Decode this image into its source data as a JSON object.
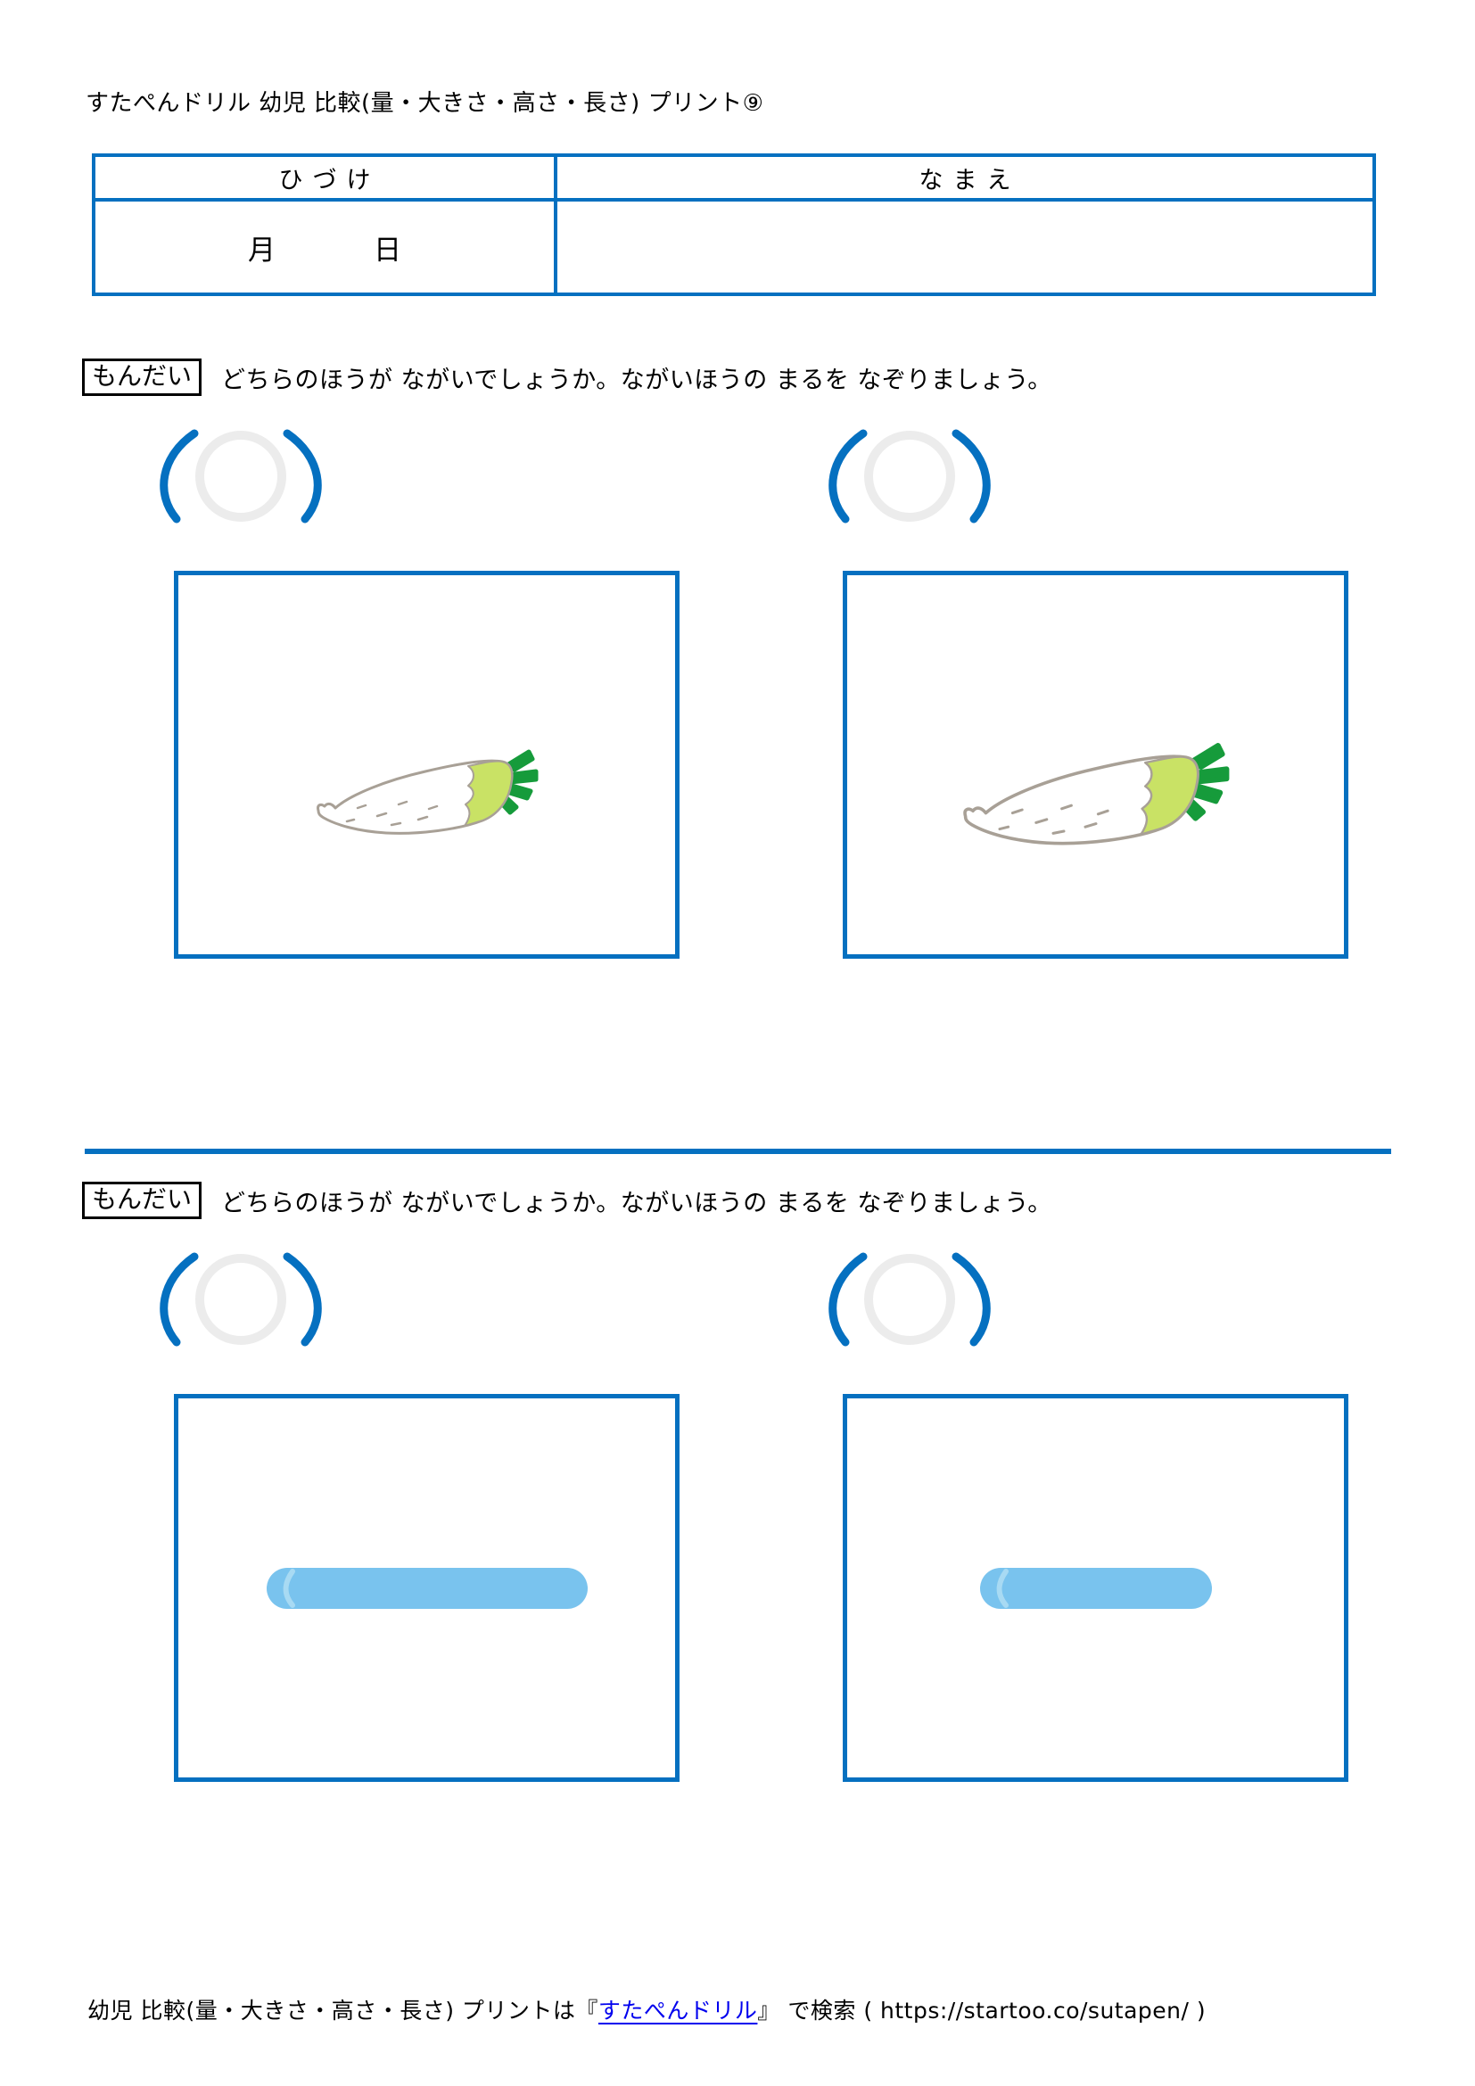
{
  "header": {
    "title": "すたぺんドリル  幼児  比較(量・大きさ・高さ・長さ)  プリント⑨"
  },
  "info_table": {
    "headers": [
      "ひづけ",
      "なまえ"
    ],
    "date_month_label": "月",
    "date_day_label": "日",
    "name_value": ""
  },
  "problems": [
    {
      "badge": "もんだい",
      "prompt": "どちらのほうが ながいでしょうか。ながいほうの まるを なぞりましょう。",
      "choices": [
        {
          "label": "",
          "item": "daikon-radish",
          "relative_length": "shorter"
        },
        {
          "label": "",
          "item": "daikon-radish",
          "relative_length": "longer"
        }
      ]
    },
    {
      "badge": "もんだい",
      "prompt": "どちらのほうが ながいでしょうか。ながいほうの まるを なぞりましょう。",
      "choices": [
        {
          "label": "",
          "item": "blue-stick",
          "relative_length": "longer"
        },
        {
          "label": "",
          "item": "blue-stick",
          "relative_length": "shorter"
        }
      ]
    }
  ],
  "footer": {
    "prefix": "幼児  比較(量・大きさ・高さ・長さ)  プリントは『",
    "brand": "すたぺんドリル",
    "suffix": "』  で検索 ( https://startoo.co/sutapen/ )"
  },
  "colors": {
    "frame_blue": "#0570C0",
    "paren_blue": "#0570C0",
    "trace_circle_gray": "#ECECEC",
    "stick_blue": "#79C3EE",
    "link_blue": "#0000EE",
    "radish_outline": "#A8A096",
    "radish_leaf_light": "#C9E265",
    "radish_leaf_dark": "#169B3B"
  }
}
